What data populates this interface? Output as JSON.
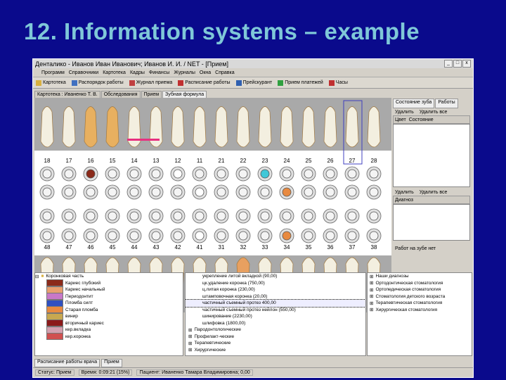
{
  "slide_title": "12. Information systems – example",
  "window": {
    "title": "Денталико - Иванов Иван Иванович; Иванов И. И. / NET - [Прием]",
    "controls": [
      "_",
      "□",
      "x"
    ]
  },
  "menu": [
    "Программ",
    "Справочники",
    "Картотека",
    "Кадры",
    "Финансы",
    "Журналы",
    "Окна",
    "Справка"
  ],
  "toolbar": [
    {
      "label": "Картотека",
      "icon": "folder-icon"
    },
    {
      "label": "Распорядок работы",
      "icon": "calendar-icon"
    },
    {
      "label": "Журнал приема",
      "icon": "journal-icon"
    },
    {
      "label": "Расписание работы",
      "icon": "schedule-icon"
    },
    {
      "label": "Прейскурант",
      "icon": "pricelist-icon"
    },
    {
      "label": "Прием платежей",
      "icon": "payment-icon"
    },
    {
      "label": "Часы",
      "icon": "clock-icon"
    }
  ],
  "tabs": [
    "Картотека : Иваненко Т. В.",
    "Обследования",
    "Прием",
    "Зубная формула"
  ],
  "tooth_numbers_upper": [
    "18",
    "17",
    "16",
    "15",
    "14",
    "13",
    "12",
    "11",
    "21",
    "22",
    "23",
    "24",
    "25",
    "26",
    "27",
    "28"
  ],
  "tooth_numbers_lower": [
    "48",
    "47",
    "46",
    "45",
    "44",
    "43",
    "42",
    "41",
    "31",
    "32",
    "33",
    "34",
    "35",
    "36",
    "37",
    "38"
  ],
  "right_panel": {
    "tabs": [
      "Состояние зуба",
      "Работы"
    ],
    "actions_top": [
      "Удалить",
      "Удалить все"
    ],
    "columns": [
      "Цвет",
      "Состояние"
    ],
    "actions_mid": [
      "Удалить",
      "Удалить все"
    ],
    "diagnosis_label": "Диагноз",
    "footer": "Работ на зубе нет"
  },
  "left_tree": {
    "root": "Коронковая часть",
    "items": [
      {
        "label": "Кариес глубокий",
        "color": "#8b2a1a"
      },
      {
        "label": "Кариес начальный",
        "color": "#e8a070"
      },
      {
        "label": "Периодонтит",
        "color": "#c878c8"
      },
      {
        "label": "Пломба силт",
        "color": "#3050c0"
      },
      {
        "label": "Старая пломба",
        "color": "#e88a40"
      },
      {
        "label": "винир",
        "color": "#c8a850"
      },
      {
        "label": "вторичный кариес",
        "color": "#8b1a1a"
      },
      {
        "label": "кер.вкладка",
        "color": "#d4a0b0"
      },
      {
        "label": "кер.коронка",
        "color": "#d05050"
      }
    ]
  },
  "mid_list": {
    "items": [
      "укрепление литой вкладкой (90,00)",
      "цк.удаление коронка (750,00)",
      "ц.литая коронка (230,00)",
      "штамповочная коронка (20,00)",
      "частичный съемный протез 400,00",
      "частичный съемный протез нейлон (550,00)",
      "шинирование (2230,00)",
      "шлифовка (1800,00)"
    ],
    "selected_index": 4,
    "groups": [
      "Пародонтологические",
      "Профилакт-ческие",
      "Терапевтические",
      "Хирургические"
    ]
  },
  "right_list": [
    "Наши диагнозы",
    "Ортодонтическая стоматология",
    "Ортопедическая стоматология",
    "Стоматология детского возраста",
    "Терапевтическая стоматология",
    "Хирургическая стоматология"
  ],
  "bottom_tabs": [
    "Расписание работы врача",
    "Прием"
  ],
  "status": [
    "Статус: Прием",
    "Время: 0:09:21 (15%)",
    "Пациент: Иваненко Тамара Владимировна; 0,00"
  ]
}
